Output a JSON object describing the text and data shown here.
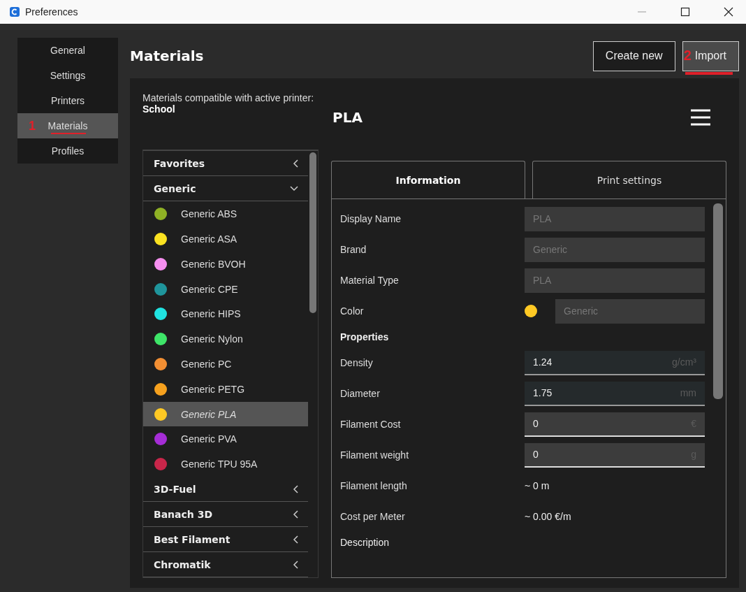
{
  "window": {
    "title": "Preferences"
  },
  "sidebar": {
    "items": [
      {
        "label": "General",
        "selected": false
      },
      {
        "label": "Settings",
        "selected": false
      },
      {
        "label": "Printers",
        "selected": false
      },
      {
        "label": "Materials",
        "selected": true,
        "annotation": "1"
      },
      {
        "label": "Profiles",
        "selected": false
      }
    ]
  },
  "page_title": "Materials",
  "buttons": [
    {
      "label": "Create new"
    },
    {
      "label": "Import",
      "annotation": "2"
    }
  ],
  "compatible": {
    "text": "Materials compatible with active printer:",
    "printer": "School"
  },
  "categories": [
    {
      "name": "Favorites",
      "expanded": false
    },
    {
      "name": "Generic",
      "expanded": true,
      "children": [
        {
          "name": "Generic ABS",
          "color": "#8fb125",
          "selected": false
        },
        {
          "name": "Generic ASA",
          "color": "#fbe221",
          "selected": false
        },
        {
          "name": "Generic BVOH",
          "color": "#f68ff0",
          "selected": false
        },
        {
          "name": "Generic CPE",
          "color": "#1f959c",
          "selected": false
        },
        {
          "name": "Generic HIPS",
          "color": "#20e3e1",
          "selected": false
        },
        {
          "name": "Generic Nylon",
          "color": "#3ee568",
          "selected": false
        },
        {
          "name": "Generic PC",
          "color": "#f38f33",
          "selected": false
        },
        {
          "name": "Generic PETG",
          "color": "#f6a11e",
          "selected": false
        },
        {
          "name": "Generic PLA",
          "color": "#ffc924",
          "selected": true
        },
        {
          "name": "Generic PVA",
          "color": "#a52dd6",
          "selected": false
        },
        {
          "name": "Generic TPU 95A",
          "color": "#c9264a",
          "selected": false
        }
      ]
    },
    {
      "name": "3D-Fuel",
      "expanded": false
    },
    {
      "name": "Banach 3D",
      "expanded": false
    },
    {
      "name": "Best Filament",
      "expanded": false
    },
    {
      "name": "Chromatik",
      "expanded": false
    }
  ],
  "material_title": "PLA",
  "tabs": [
    {
      "label": "Information",
      "selected": true
    },
    {
      "label": "Print settings",
      "selected": false
    }
  ],
  "properties": [
    {
      "kind": "field",
      "label": "Display Name",
      "value": "PLA"
    },
    {
      "kind": "field",
      "label": "Brand",
      "value": "Generic"
    },
    {
      "kind": "field",
      "label": "Material Type",
      "value": "PLA"
    },
    {
      "kind": "color",
      "label": "Color",
      "value": "Generic",
      "color": "#ffc924"
    },
    {
      "kind": "heading",
      "label": "Properties"
    },
    {
      "kind": "unit-field",
      "label": "Density",
      "value": "1.24",
      "unit": "g/cm³",
      "highlighted": false
    },
    {
      "kind": "unit-field",
      "label": "Diameter",
      "value": "1.75",
      "unit": "mm",
      "highlighted": false
    },
    {
      "kind": "unit-field",
      "label": "Filament Cost",
      "value": "0",
      "unit": "€",
      "highlighted": true
    },
    {
      "kind": "unit-field",
      "label": "Filament weight",
      "value": "0",
      "unit": "g",
      "highlighted": true
    },
    {
      "kind": "text",
      "label": "Filament length",
      "value": "~ 0 m"
    },
    {
      "kind": "text",
      "label": "Cost per Meter",
      "value": "~ 0.00 €/m"
    },
    {
      "kind": "heading",
      "label": "Description"
    }
  ]
}
